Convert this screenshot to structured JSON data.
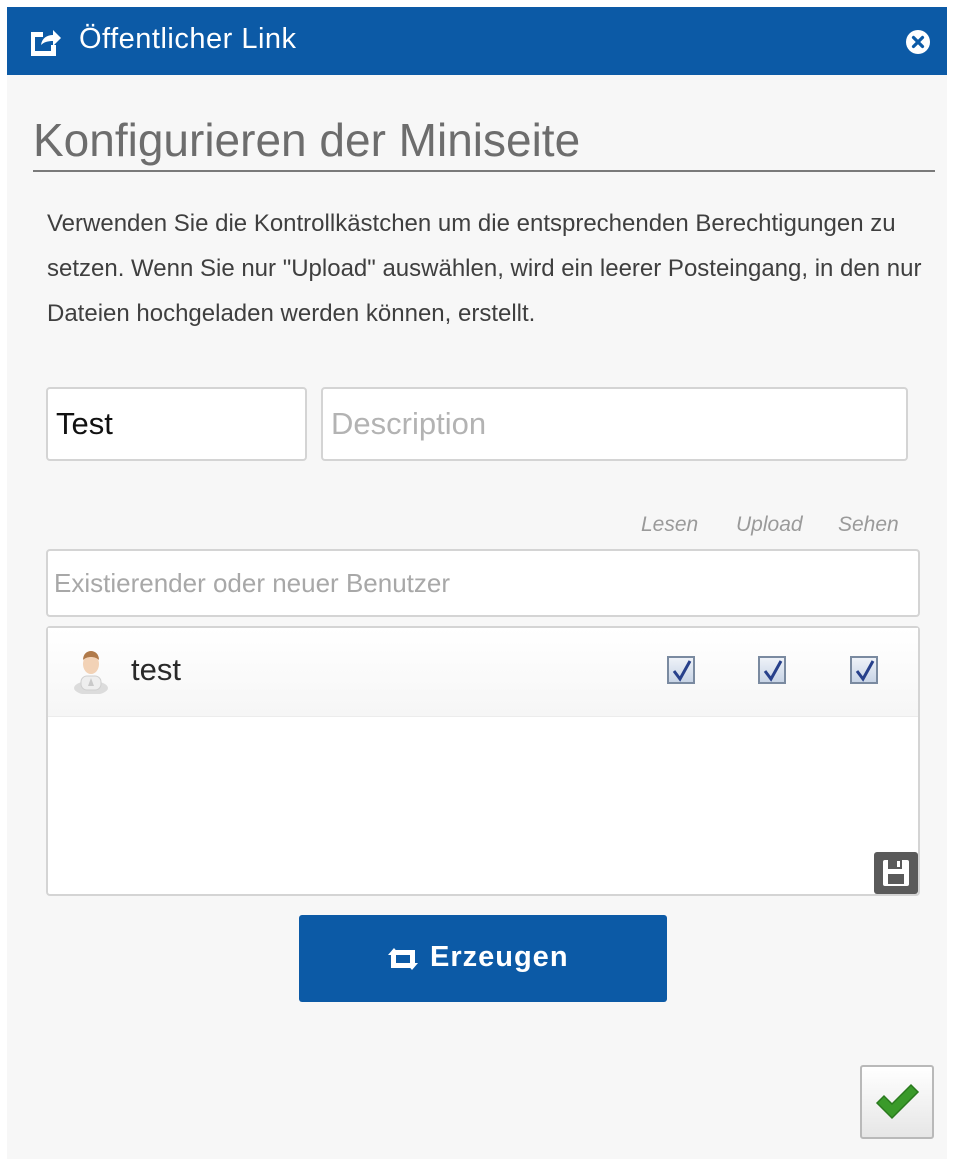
{
  "dialog": {
    "title": "Öffentlicher Link",
    "title_icon": "share-icon",
    "close_icon": "close-icon"
  },
  "main": {
    "heading": "Konfigurieren der Miniseite",
    "description": "Verwenden Sie die Kontrollkästchen um die entsprechenden Berechtigungen zu setzen. Wenn Sie nur \"Upload\" auswählen, wird ein leerer Posteingang, in den nur Dateien hochgeladen werden können, erstellt.",
    "name_value": "Test",
    "description_placeholder": "Description",
    "columns": [
      "Lesen",
      "Upload",
      "Sehen"
    ],
    "user_placeholder": "Existierender oder neuer Benutzer",
    "users": [
      {
        "name": "test",
        "lesen": true,
        "upload": true,
        "sehen": true
      }
    ],
    "save_icon": "floppy-disk-icon"
  },
  "actions": {
    "generate_label": "Erzeugen",
    "generate_icon": "retweet-icon",
    "confirm_icon": "checkmark-icon"
  },
  "colors": {
    "accent": "#0c5aa6",
    "check": "#3a9a2a"
  }
}
